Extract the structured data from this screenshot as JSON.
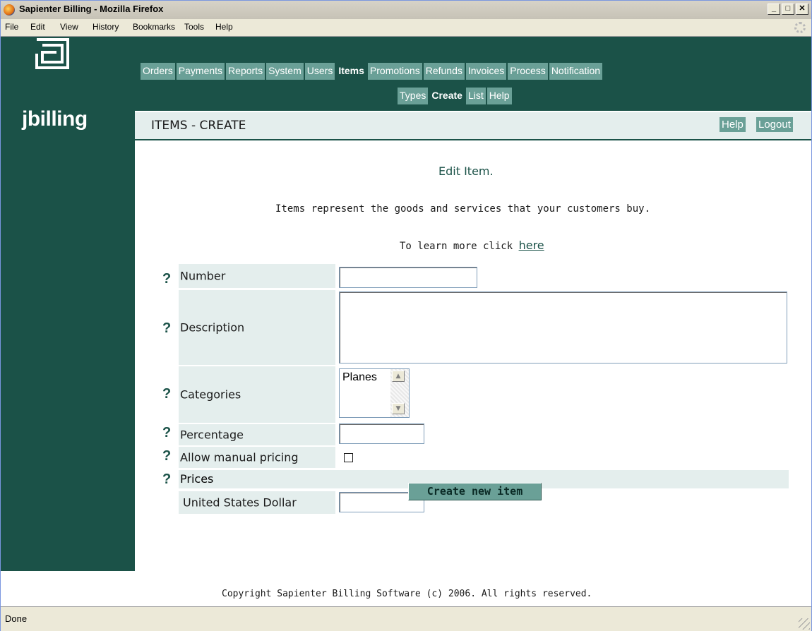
{
  "window": {
    "title": "Sapienter Billing - Mozilla Firefox"
  },
  "menubar": [
    "File",
    "Edit",
    "View",
    "History",
    "Bookmarks",
    "Tools",
    "Help"
  ],
  "brand": {
    "name": "jbilling"
  },
  "nav": {
    "main": [
      "Orders",
      "Payments",
      "Reports",
      "System",
      "Users",
      "Items",
      "Promotions",
      "Refunds",
      "Invoices",
      "Process",
      "Notification"
    ],
    "main_active": "Items",
    "sub": [
      "Types",
      "Create",
      "List",
      "Help"
    ],
    "sub_active": "Create"
  },
  "page": {
    "title": "ITEMS - CREATE",
    "help_label": "Help",
    "logout_label": "Logout",
    "heading": "Edit Item.",
    "intro": "Items represent the goods and services that your customers buy.",
    "learn_prefix": "To learn more click ",
    "learn_link": "here"
  },
  "form": {
    "help_glyph": "?",
    "number_label": "Number",
    "number_value": "",
    "description_label": "Description",
    "description_value": "",
    "categories_label": "Categories",
    "categories_options": [
      "Planes"
    ],
    "percentage_label": "Percentage",
    "percentage_value": "",
    "allow_manual_pricing_label": "Allow manual pricing",
    "allow_manual_pricing_checked": false,
    "prices_label": "Prices",
    "currency_label": "United States Dollar",
    "currency_value": "",
    "submit_label": "Create new item"
  },
  "footer": {
    "copyright": "Copyright Sapienter Billing Software (c) 2006. All rights reserved."
  },
  "status": {
    "text": "Done"
  },
  "colors": {
    "primary": "#1b5248",
    "nav_button": "#6aa097",
    "label_bg": "#e4eeed"
  }
}
